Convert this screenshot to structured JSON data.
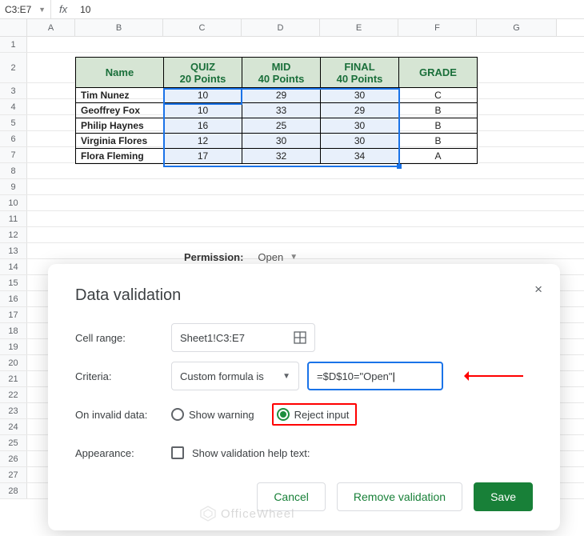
{
  "namebox": "C3:E7",
  "fx_label": "fx",
  "formula": "10",
  "columns": [
    "A",
    "B",
    "C",
    "D",
    "E",
    "F",
    "G"
  ],
  "rownums": [
    "1",
    "2",
    "3",
    "4",
    "5",
    "6",
    "7",
    "8",
    "9",
    "10",
    "11",
    "12",
    "13",
    "14",
    "15",
    "16",
    "17",
    "18",
    "19",
    "20",
    "21",
    "22",
    "23",
    "24",
    "25",
    "26",
    "27",
    "28"
  ],
  "table": {
    "headers": {
      "name": "Name",
      "quiz_l1": "QUIZ",
      "quiz_l2": "20 Points",
      "mid_l1": "MID",
      "mid_l2": "40 Points",
      "final_l1": "FINAL",
      "final_l2": "40 Points",
      "grade": "GRADE"
    },
    "rows": [
      {
        "name": "Tim Nunez",
        "quiz": "10",
        "mid": "29",
        "final": "30",
        "grade": "C"
      },
      {
        "name": "Geoffrey Fox",
        "quiz": "10",
        "mid": "33",
        "final": "29",
        "grade": "B"
      },
      {
        "name": "Philip Haynes",
        "quiz": "16",
        "mid": "25",
        "final": "30",
        "grade": "B"
      },
      {
        "name": "Virginia Flores",
        "quiz": "12",
        "mid": "30",
        "final": "30",
        "grade": "B"
      },
      {
        "name": "Flora Fleming",
        "quiz": "17",
        "mid": "32",
        "final": "34",
        "grade": "A"
      }
    ]
  },
  "permission": {
    "label": "Permission:",
    "value": "Open"
  },
  "dialog": {
    "title": "Data validation",
    "close": "×",
    "cell_range_label": "Cell range:",
    "cell_range_value": "Sheet1!C3:E7",
    "criteria_label": "Criteria:",
    "criteria_type": "Custom formula is",
    "criteria_formula": "=$D$10=\"Open\"",
    "invalid_label": "On invalid data:",
    "opt_warning": "Show warning",
    "opt_reject": "Reject input",
    "appearance_label": "Appearance:",
    "appearance_help": "Show validation help text:",
    "btn_cancel": "Cancel",
    "btn_remove": "Remove validation",
    "btn_save": "Save"
  },
  "watermark": "OfficeWheel",
  "chart_data": {
    "type": "table",
    "columns": [
      "Name",
      "QUIZ 20 Points",
      "MID 40 Points",
      "FINAL 40 Points",
      "GRADE"
    ],
    "rows": [
      [
        "Tim Nunez",
        10,
        29,
        30,
        "C"
      ],
      [
        "Geoffrey Fox",
        10,
        33,
        29,
        "B"
      ],
      [
        "Philip Haynes",
        16,
        25,
        30,
        "B"
      ],
      [
        "Virginia Flores",
        12,
        30,
        30,
        "B"
      ],
      [
        "Flora Fleming",
        17,
        32,
        34,
        "A"
      ]
    ]
  }
}
